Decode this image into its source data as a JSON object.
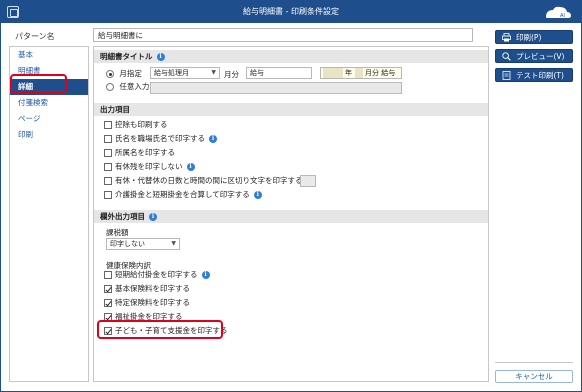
{
  "window": {
    "title": "給与明細書 - 印刷条件設定"
  },
  "pattern": {
    "label": "パターン名",
    "value": "給与明細書に"
  },
  "sidebar": {
    "items": [
      {
        "label": "基本"
      },
      {
        "label": "明細書"
      },
      {
        "label": "詳細"
      },
      {
        "label": "付箋検索"
      },
      {
        "label": "ページ"
      },
      {
        "label": "印刷"
      }
    ]
  },
  "title_section": {
    "header": "明細書タイトル",
    "radio_month": "月指定",
    "month_select": "給与処理月",
    "month_unit": "月分",
    "kind_value": "給与",
    "preview_year": "年",
    "preview_month": "月分 給与",
    "radio_free": "任意入力"
  },
  "output_section": {
    "header": "出力項目",
    "items": [
      {
        "label": "控除も印刷する",
        "checked": false
      },
      {
        "label": "氏名を職場氏名で印字する",
        "checked": false
      },
      {
        "label": "所属名を印字する",
        "checked": false
      },
      {
        "label": "有休残を印字しない",
        "checked": false
      },
      {
        "label": "有休・代替休の日数と時間の間に区切り文字を印字する",
        "checked": false
      },
      {
        "label": "介護掛金と短期掛金を合算して印字する",
        "checked": false
      }
    ]
  },
  "extra_section": {
    "header": "欄外出力項目",
    "tax_label": "課税額",
    "tax_select": "印字しない",
    "health_label": "健康保険内訳",
    "items": [
      {
        "label": "短期給付掛金を印字する",
        "checked": false
      },
      {
        "label": "基本保険料を印字する",
        "checked": true
      },
      {
        "label": "特定保険料を印字する",
        "checked": true
      },
      {
        "label": "福祉掛金を印字する",
        "checked": true
      },
      {
        "label": "子ども・子育て支援金を印字する",
        "checked": true
      }
    ]
  },
  "actions": {
    "print": "印刷(P)",
    "preview": "プレビュー(V)",
    "test_print": "テスト印刷(T)",
    "cancel": "キャンセル"
  },
  "colors": {
    "accent": "#1f4e8c",
    "highlight": "#e0001b",
    "info": "#2f7fd6"
  }
}
